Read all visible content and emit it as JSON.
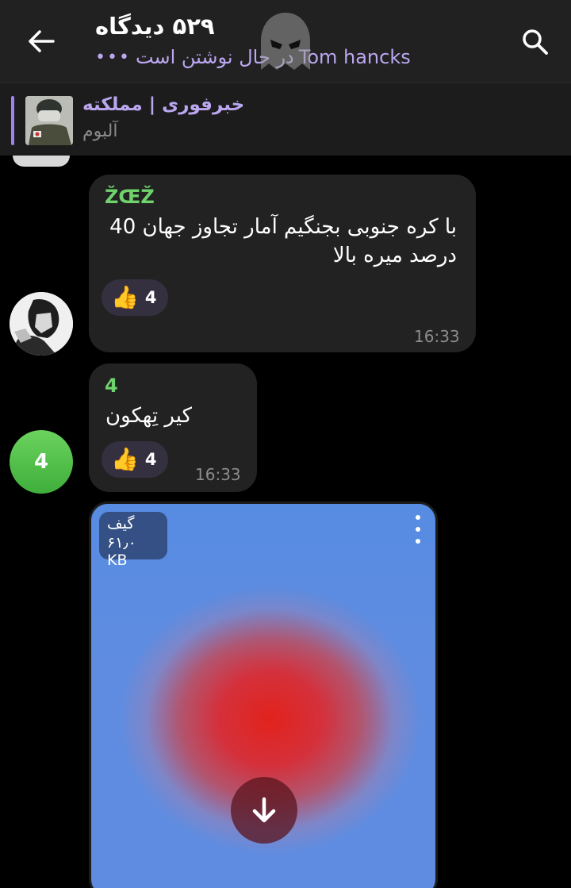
{
  "header": {
    "title": "۵۲۹ دیدگاه",
    "typing_user": "Tom hancks",
    "typing_text": "در حال نوشتن است",
    "typing_dots": "•••"
  },
  "pinned": {
    "name": "خبرفوری | مملکته",
    "subtitle": "آلبوم"
  },
  "messages": [
    {
      "sender": "ŽŒŽ",
      "text": "با کره جنوبی بجنگیم آمار تجاوز جهان 40 درصد میره بالا",
      "reaction_count": "4",
      "time": "16:33"
    },
    {
      "sender": "4",
      "avatar_letter": "4",
      "text": "کیر تِهکون",
      "reaction_count": "4",
      "time": "16:33"
    }
  ],
  "gif": {
    "type_label": "گیف",
    "size": "۶۱٫۰ KB"
  },
  "colors": {
    "accent": "#bba7f0",
    "sender_green": "#6fd36b",
    "bubble": "#222222",
    "topbar": "#212121"
  }
}
